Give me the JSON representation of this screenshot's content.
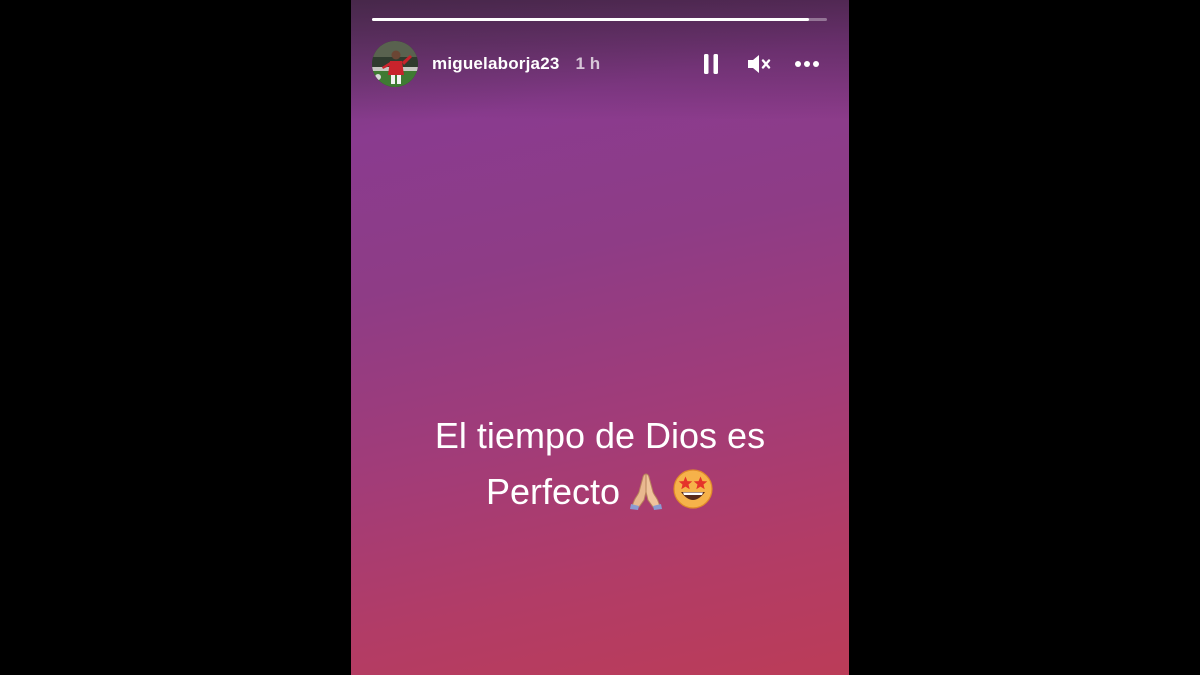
{
  "story": {
    "progress": 0.96,
    "username": "miguelaborja23",
    "time_ago": "1 h",
    "caption_line1": "El tiempo de Dios es",
    "caption_line2": "Perfecto",
    "emojis": [
      "folded-hands",
      "star-struck"
    ],
    "background_colors": [
      "#6d3a74",
      "#8a3b8f",
      "#a23c78",
      "#bb3c58"
    ]
  },
  "controls": {
    "pause": "pause-icon",
    "mute": "muted-speaker-icon",
    "more": "more-options-icon"
  }
}
